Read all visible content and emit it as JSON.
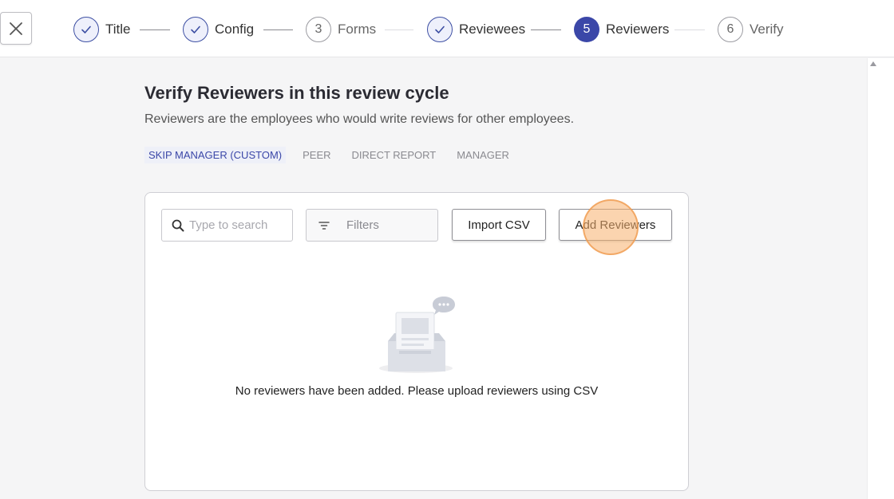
{
  "stepper": {
    "steps": [
      {
        "label": "Title",
        "status": "done"
      },
      {
        "label": "Config",
        "status": "done"
      },
      {
        "label": "Forms",
        "status": "todo",
        "number": "3"
      },
      {
        "label": "Reviewees",
        "status": "done"
      },
      {
        "label": "Reviewers",
        "status": "active",
        "number": "5"
      },
      {
        "label": "Verify",
        "status": "todo",
        "number": "6"
      }
    ]
  },
  "page": {
    "title": "Verify Reviewers in this review cycle",
    "subtitle": "Reviewers are the employees who would write reviews for other employees."
  },
  "tabs": [
    {
      "label": "SKIP MANAGER (CUSTOM)",
      "active": true
    },
    {
      "label": "PEER",
      "active": false
    },
    {
      "label": "DIRECT REPORT",
      "active": false
    },
    {
      "label": "MANAGER",
      "active": false
    }
  ],
  "toolbar": {
    "search_placeholder": "Type to search",
    "filters_label": "Filters",
    "import_label": "Import CSV",
    "add_label": "Add Reviewers"
  },
  "empty_state": {
    "message": "No reviewers have been added. Please upload reviewers using CSV"
  },
  "colors": {
    "accent": "#3b47a8",
    "highlight": "#f8b06e"
  }
}
